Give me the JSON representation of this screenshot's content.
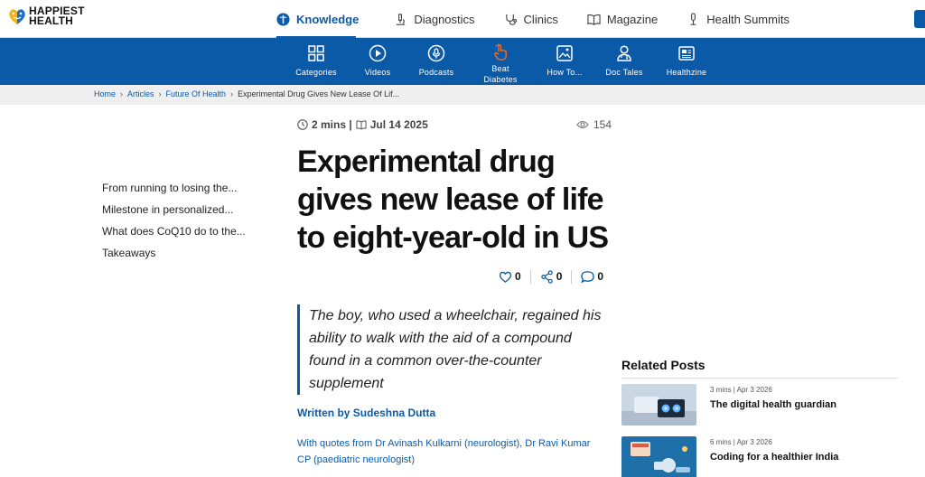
{
  "brand": {
    "line1": "HAPPIEST",
    "line2": "HEALTH",
    "colors": {
      "primary": "#0a5aa8",
      "accent_orange": "#f26b21"
    }
  },
  "topnav": [
    {
      "label": "Knowledge",
      "icon": "knowledge-icon",
      "active": true
    },
    {
      "label": "Diagnostics",
      "icon": "microscope-icon"
    },
    {
      "label": "Clinics",
      "icon": "stethoscope-icon"
    },
    {
      "label": "Magazine",
      "icon": "book-icon"
    },
    {
      "label": "Health Summits",
      "icon": "mic-icon"
    }
  ],
  "categories": [
    {
      "label": "Categories",
      "icon": "grid-icon"
    },
    {
      "label": "Videos",
      "icon": "play-icon"
    },
    {
      "label": "Podcasts",
      "icon": "podcast-icon"
    },
    {
      "label": "Beat Diabetes",
      "icon": "finger-tap-icon"
    },
    {
      "label": "How To...",
      "icon": "image-icon"
    },
    {
      "label": "Doc Tales",
      "icon": "doctor-icon"
    },
    {
      "label": "Healthzine",
      "icon": "newspaper-icon"
    }
  ],
  "breadcrumb": {
    "home": "Home",
    "articles": "Articles",
    "section": "Future Of Health",
    "current": "Experimental Drug Gives New Lease Of Lif..."
  },
  "toc": [
    "From running to losing the...",
    "Milestone in personalized...",
    "What does CoQ10 do to the...",
    "Takeaways"
  ],
  "article": {
    "read_time": "2 mins |",
    "date": "Jul 14 2025",
    "views": "154",
    "title": "Experimental drug gives new lease of life to eight-year-old in US",
    "likes": "0",
    "shares": "0",
    "comments": "0",
    "summary": "The boy, who used a wheelchair, regained his ability to walk with the aid of a compound found in a common over-the-counter supplement",
    "author": "Written by Sudeshna Dutta",
    "quotes": "With quotes from Dr Avinash Kulkarni (neurologist), Dr Ravi Kumar CP (paediatric neurologist)"
  },
  "related": {
    "heading": "Related Posts",
    "posts": [
      {
        "meta": "3 mins | Apr 3 2026",
        "title": "The digital health guardian"
      },
      {
        "meta": "6 mins | Apr 3 2026",
        "title": "Coding for a healthier India"
      }
    ]
  }
}
